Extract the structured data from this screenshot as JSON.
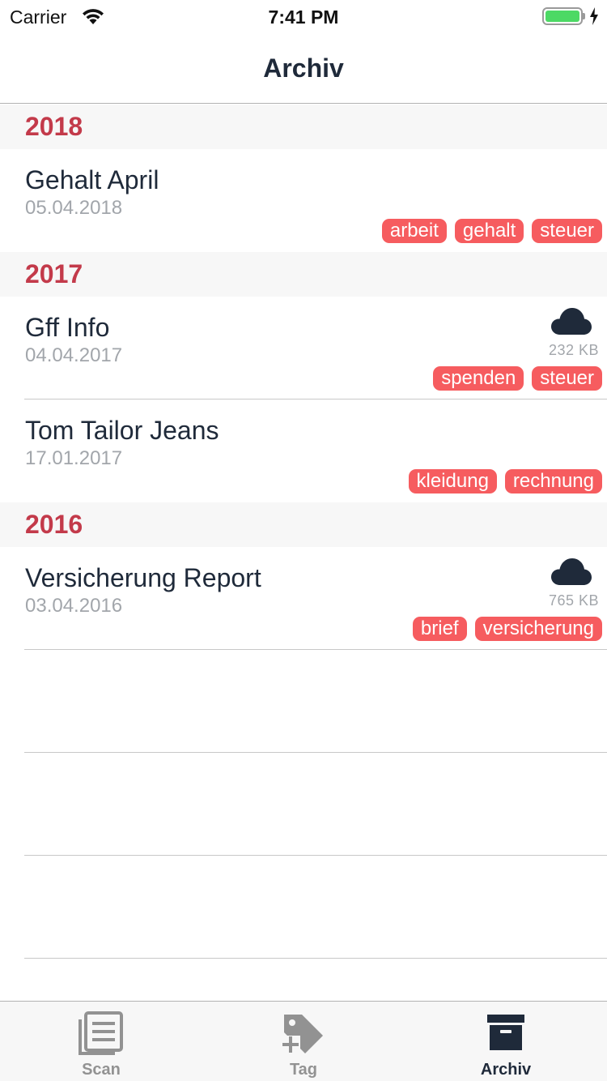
{
  "status": {
    "carrier": "Carrier",
    "time": "7:41 PM"
  },
  "nav": {
    "title": "Archiv"
  },
  "sections": [
    {
      "year": "2018",
      "rows": [
        {
          "title": "Gehalt April",
          "date": "05.04.2018",
          "tags": [
            "arbeit",
            "gehalt",
            "steuer"
          ]
        }
      ]
    },
    {
      "year": "2017",
      "rows": [
        {
          "title": "Gff Info",
          "date": "04.04.2017",
          "size": "232 KB",
          "tags": [
            "spenden",
            "steuer"
          ]
        },
        {
          "title": "Tom Tailor Jeans",
          "date": "17.01.2017",
          "tags": [
            "kleidung",
            "rechnung"
          ]
        }
      ]
    },
    {
      "year": "2016",
      "rows": [
        {
          "title": "Versicherung Report",
          "date": "03.04.2016",
          "size": "765 KB",
          "tags": [
            "brief",
            "versicherung"
          ]
        }
      ]
    }
  ],
  "tabs": [
    {
      "label": "Scan",
      "icon": "document-list-icon"
    },
    {
      "label": "Tag",
      "icon": "tag-add-icon"
    },
    {
      "label": "Archiv",
      "icon": "archive-box-icon"
    }
  ],
  "colors": {
    "accent": "#c33a4a",
    "tag": "#f65c5f",
    "text": "#1f2a3a",
    "muted": "#a2a6ab",
    "battery": "#4cd964"
  }
}
